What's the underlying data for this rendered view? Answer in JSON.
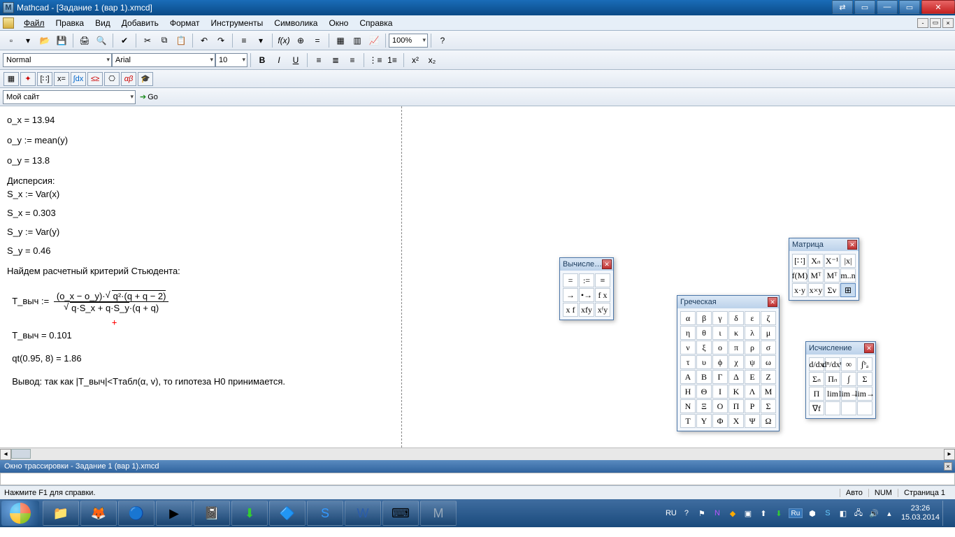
{
  "title": "Mathcad - [Задание 1 (вар 1).xmcd]",
  "menu": [
    "Файл",
    "Правка",
    "Вид",
    "Добавить",
    "Формат",
    "Инструменты",
    "Символика",
    "Окно",
    "Справка"
  ],
  "menu_accel": [
    0,
    0,
    0,
    0,
    0,
    0,
    0,
    0,
    0
  ],
  "format_dropdowns": {
    "style": "Normal",
    "font": "Arial",
    "size": "10",
    "zoom": "100%"
  },
  "site_label": "Мой сайт",
  "go_label": "Go",
  "tracebar": "Окно трассировки - Задание 1 (вар 1).xmcd",
  "status_left": "Нажмите F1 для справки.",
  "status_auto": "Авто",
  "status_num": "NUM",
  "status_page": "Страница 1",
  "clock_time": "23:26",
  "clock_date": "15.03.2014",
  "lang_tray": "RU",
  "doc": {
    "l1": "o_x = 13.94",
    "l2": "o_y := mean(y)",
    "l3": "o_y = 13.8",
    "l4": "Дисперсия:",
    "l5": "S_x := Var(x)",
    "l6": "S_x = 0.303",
    "l7": "S_y := Var(y)",
    "l8": "S_y = 0.46",
    "l9": "Найдем расчетный критерий Стьюдента:",
    "formula_lhs": "T_выч :=",
    "formula_num_a": "(o_x − o_y)·",
    "formula_sqrt_top": "q²·(q + q − 2)",
    "formula_sqrt_bot": "q·S_x + q·S_y",
    "formula_den_tail": "·(q + q)",
    "l10": "T_выч = 0.101",
    "l11": "qt(0.95, 8) = 1.86",
    "l12": "Вывод: так как |T_выч|<Tтабл(α, v), то гипотеза H0 принимается."
  },
  "palettes": {
    "eval": {
      "title": "Вычисле…",
      "cells": [
        "=",
        ":=",
        "≡",
        "→",
        "•→",
        "f x",
        "x f",
        "xfy",
        "xᶠy"
      ]
    },
    "greek": {
      "title": "Греческая",
      "cells": [
        "α",
        "β",
        "γ",
        "δ",
        "ε",
        "ζ",
        "η",
        "θ",
        "ι",
        "κ",
        "λ",
        "μ",
        "ν",
        "ξ",
        "ο",
        "π",
        "ρ",
        "σ",
        "τ",
        "υ",
        "ϕ",
        "χ",
        "ψ",
        "ω",
        "Α",
        "Β",
        "Γ",
        "Δ",
        "Ε",
        "Ζ",
        "Η",
        "Θ",
        "Ι",
        "Κ",
        "Λ",
        "Μ",
        "Ν",
        "Ξ",
        "Ο",
        "Π",
        "Ρ",
        "Σ",
        "Τ",
        "Υ",
        "Φ",
        "Χ",
        "Ψ",
        "Ω"
      ]
    },
    "matrix": {
      "title": "Матрица",
      "cells": [
        "[∷]",
        "Xₙ",
        "X⁻¹",
        "|x|",
        "f(M)",
        "Mᵀ",
        "Mᵀ",
        "m..n",
        "x·y",
        "x×y",
        "Σv",
        "⊞"
      ]
    },
    "calc": {
      "title": "Исчисление",
      "cells": [
        "d/dx",
        "dⁿ/dxⁿ",
        "∞",
        "∫ᵇₐ",
        "Σₙ",
        "Πₙ",
        "∫",
        "Σ",
        "Π",
        "lim",
        "lim→",
        "lim→",
        "∇f",
        "",
        "",
        ""
      ]
    }
  },
  "taskbar_lang1": "Ru"
}
